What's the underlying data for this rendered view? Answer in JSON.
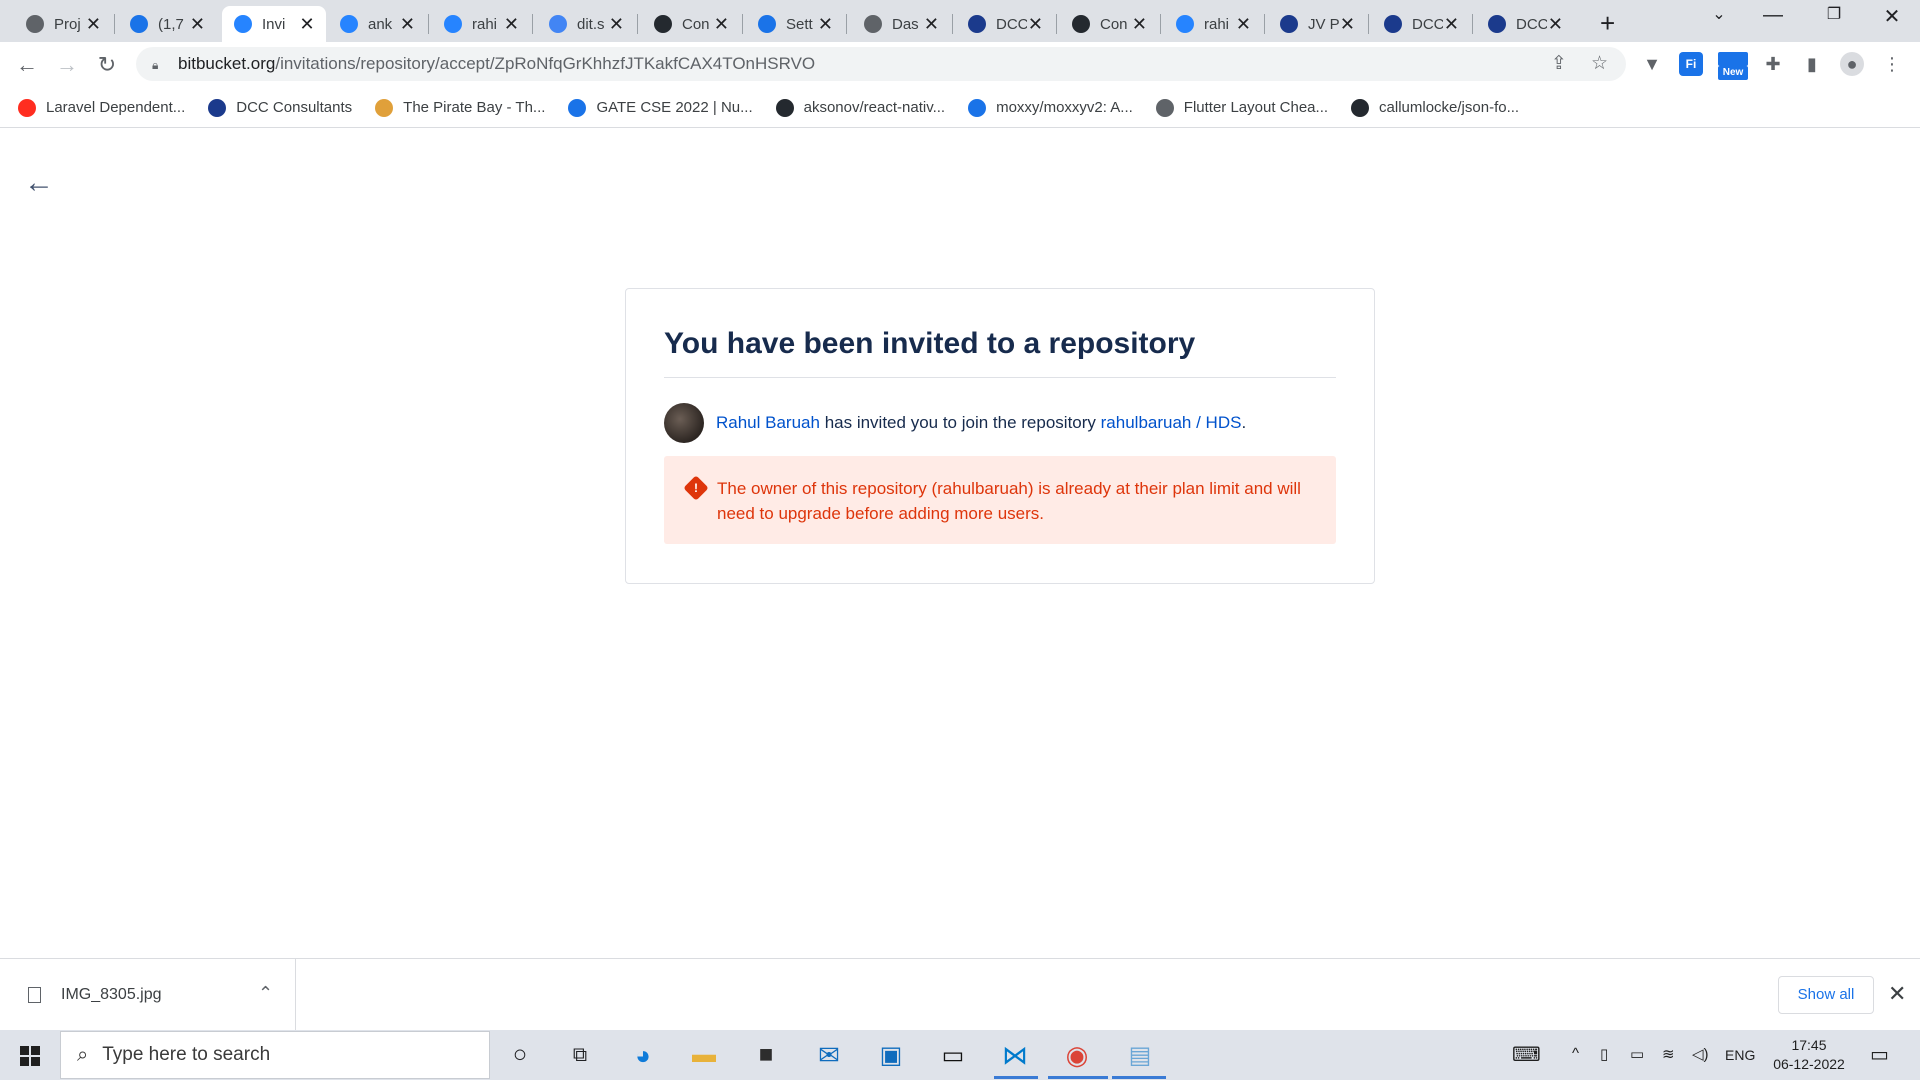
{
  "browser": {
    "tabs": [
      {
        "title": "Proj",
        "icon": "globe-icon",
        "color": "#5f6368"
      },
      {
        "title": "(1,7",
        "icon": "mail-icon",
        "color": "#1a73e8"
      },
      {
        "title": "Invi",
        "icon": "bitbucket-icon",
        "color": "#2684ff",
        "active": true
      },
      {
        "title": "ank",
        "icon": "bitbucket-icon",
        "color": "#2684ff"
      },
      {
        "title": "rahi",
        "icon": "bitbucket-icon",
        "color": "#2684ff"
      },
      {
        "title": "dit.s",
        "icon": "google-icon",
        "color": "#4285f4"
      },
      {
        "title": "Con",
        "icon": "github-icon",
        "color": "#24292f"
      },
      {
        "title": "Sett",
        "icon": "gear-icon",
        "color": "#1a73e8"
      },
      {
        "title": "Das",
        "icon": "globe-icon",
        "color": "#5f6368"
      },
      {
        "title": "DCC",
        "icon": "dcc-icon",
        "color": "#1b3a8c"
      },
      {
        "title": "Con",
        "icon": "github-icon",
        "color": "#24292f"
      },
      {
        "title": "rahi",
        "icon": "bitbucket-icon",
        "color": "#2684ff"
      },
      {
        "title": "JV P",
        "icon": "dcc-icon",
        "color": "#1b3a8c"
      },
      {
        "title": "DCC",
        "icon": "dcc-icon",
        "color": "#1b3a8c"
      },
      {
        "title": "DCC",
        "icon": "dcc-icon",
        "color": "#1b3a8c"
      }
    ],
    "url_host": "bitbucket.org",
    "url_path": "/invitations/repository/accept/ZpRoNfqGrKhhzfJTKakfCAX4TOnHSRVO",
    "extension_new_badge": "New",
    "bookmarks": [
      {
        "label": "Laravel Dependent...",
        "icon": "laravel-icon",
        "color": "#ff2d20"
      },
      {
        "label": "DCC Consultants",
        "icon": "dcc-icon",
        "color": "#1b3a8c"
      },
      {
        "label": "The Pirate Bay - Th...",
        "icon": "pirate-ship-icon",
        "color": "#e0a03a"
      },
      {
        "label": "GATE CSE 2022 | Nu...",
        "icon": "gate-icon",
        "color": "#1a73e8"
      },
      {
        "label": "aksonov/react-nativ...",
        "icon": "github-icon",
        "color": "#24292f"
      },
      {
        "label": "moxxy/moxxyv2: A...",
        "icon": "moxxy-icon",
        "color": "#1a73e8"
      },
      {
        "label": "Flutter Layout Chea...",
        "icon": "globe-icon",
        "color": "#5f6368"
      },
      {
        "label": "callumlocke/json-fo...",
        "icon": "github-icon",
        "color": "#24292f"
      }
    ]
  },
  "page": {
    "heading": "You have been invited to a repository",
    "inviter_name": "Rahul Baruah",
    "invite_text": " has invited you to join the repository ",
    "repository": "rahulbaruah / HDS",
    "invite_end": ".",
    "error_message": "The owner of this repository (rahulbaruah) is already at their plan limit and will need to upgrade before adding more users.",
    "colors": {
      "heading": "#172b4d",
      "link": "#0052cc",
      "error": "#de350b",
      "error_bg": "#ffebe6"
    }
  },
  "downloads": {
    "file_name": "IMG_8305.jpg",
    "show_all": "Show all"
  },
  "taskbar": {
    "search_placeholder": "Type here to search",
    "language": "ENG",
    "time": "17:45",
    "date": "06-12-2022"
  }
}
